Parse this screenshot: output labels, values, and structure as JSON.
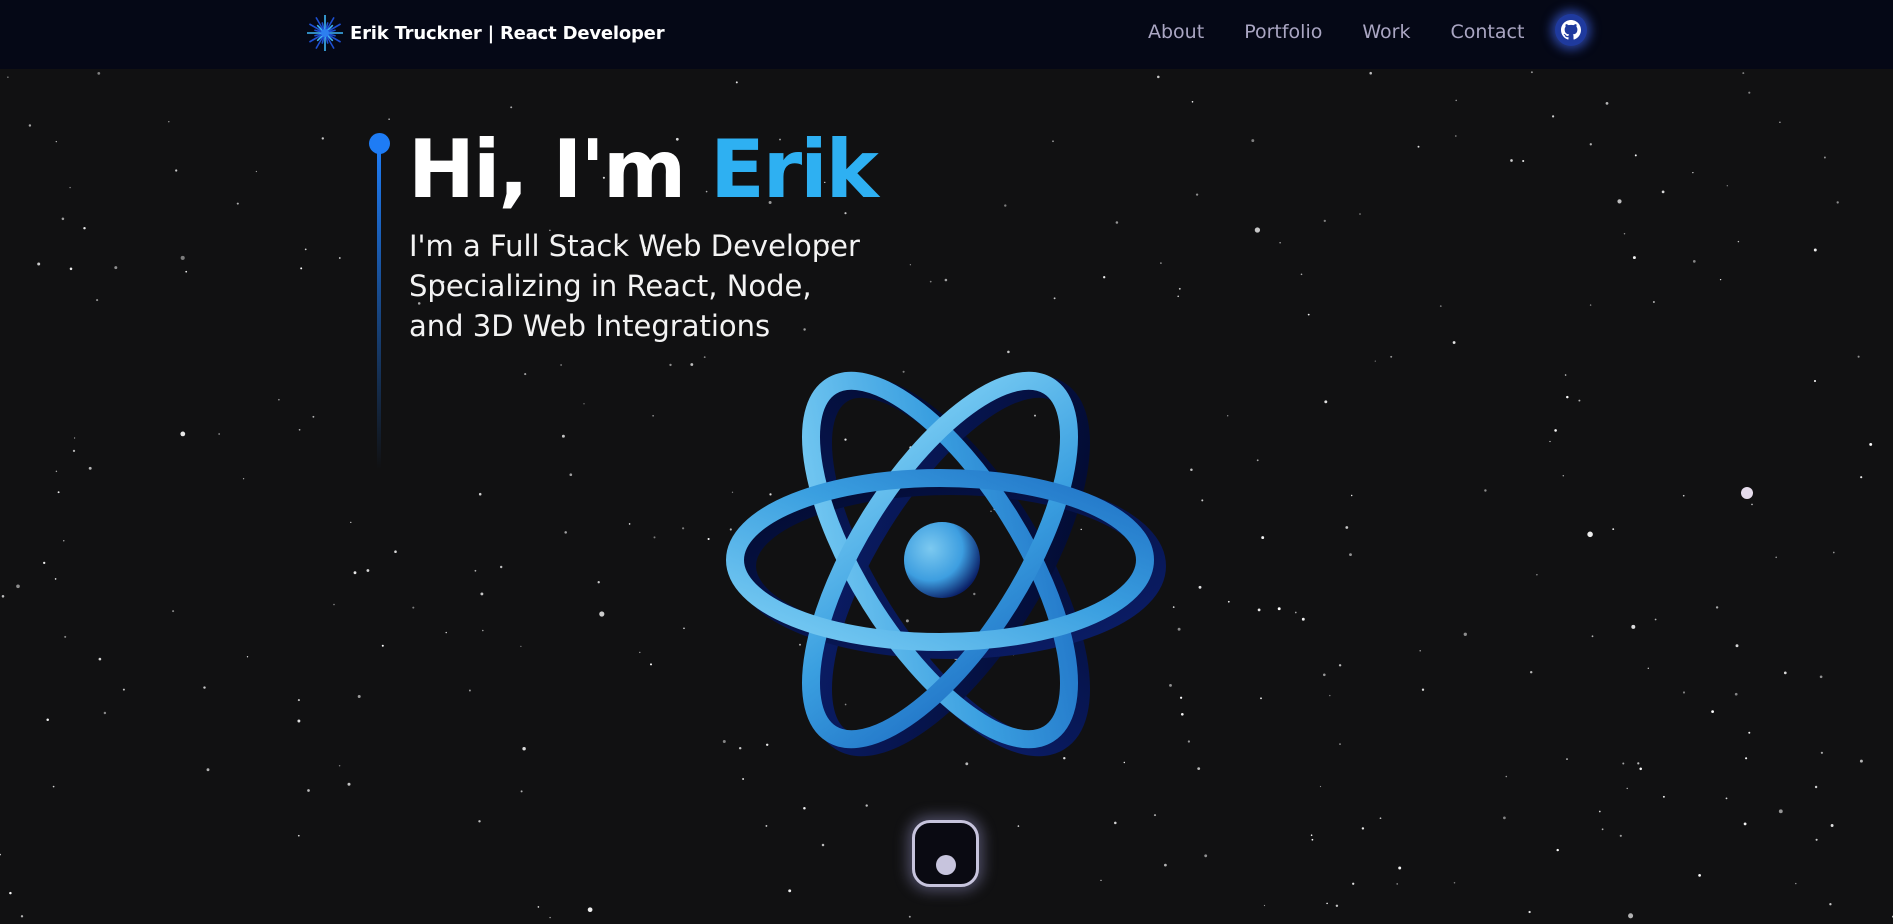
{
  "nav": {
    "brand": "Erik Truckner | React Developer",
    "links": [
      {
        "label": "About"
      },
      {
        "label": "Portfolio"
      },
      {
        "label": "Work"
      },
      {
        "label": "Contact"
      }
    ],
    "github_icon": "github-icon"
  },
  "hero": {
    "greeting": "Hi, I'm",
    "name": "Erik",
    "subtitle_lines": [
      "I'm a Full Stack Web Developer",
      "Specializing in React, Node,",
      "and 3D Web Integrations"
    ]
  },
  "icons": {
    "logo": "starburst-logo-icon",
    "scroll": "scroll-down-indicator-icon",
    "atom": "react-atom-icon"
  },
  "colors": {
    "background": "#111112",
    "navbar": "#050816",
    "nav_text": "#aaa6c3",
    "accent": "#2eb0f2",
    "timeline": "#1e7cf5",
    "atom_light": "#5fb8e6",
    "atom_dark": "#0a1f66"
  }
}
